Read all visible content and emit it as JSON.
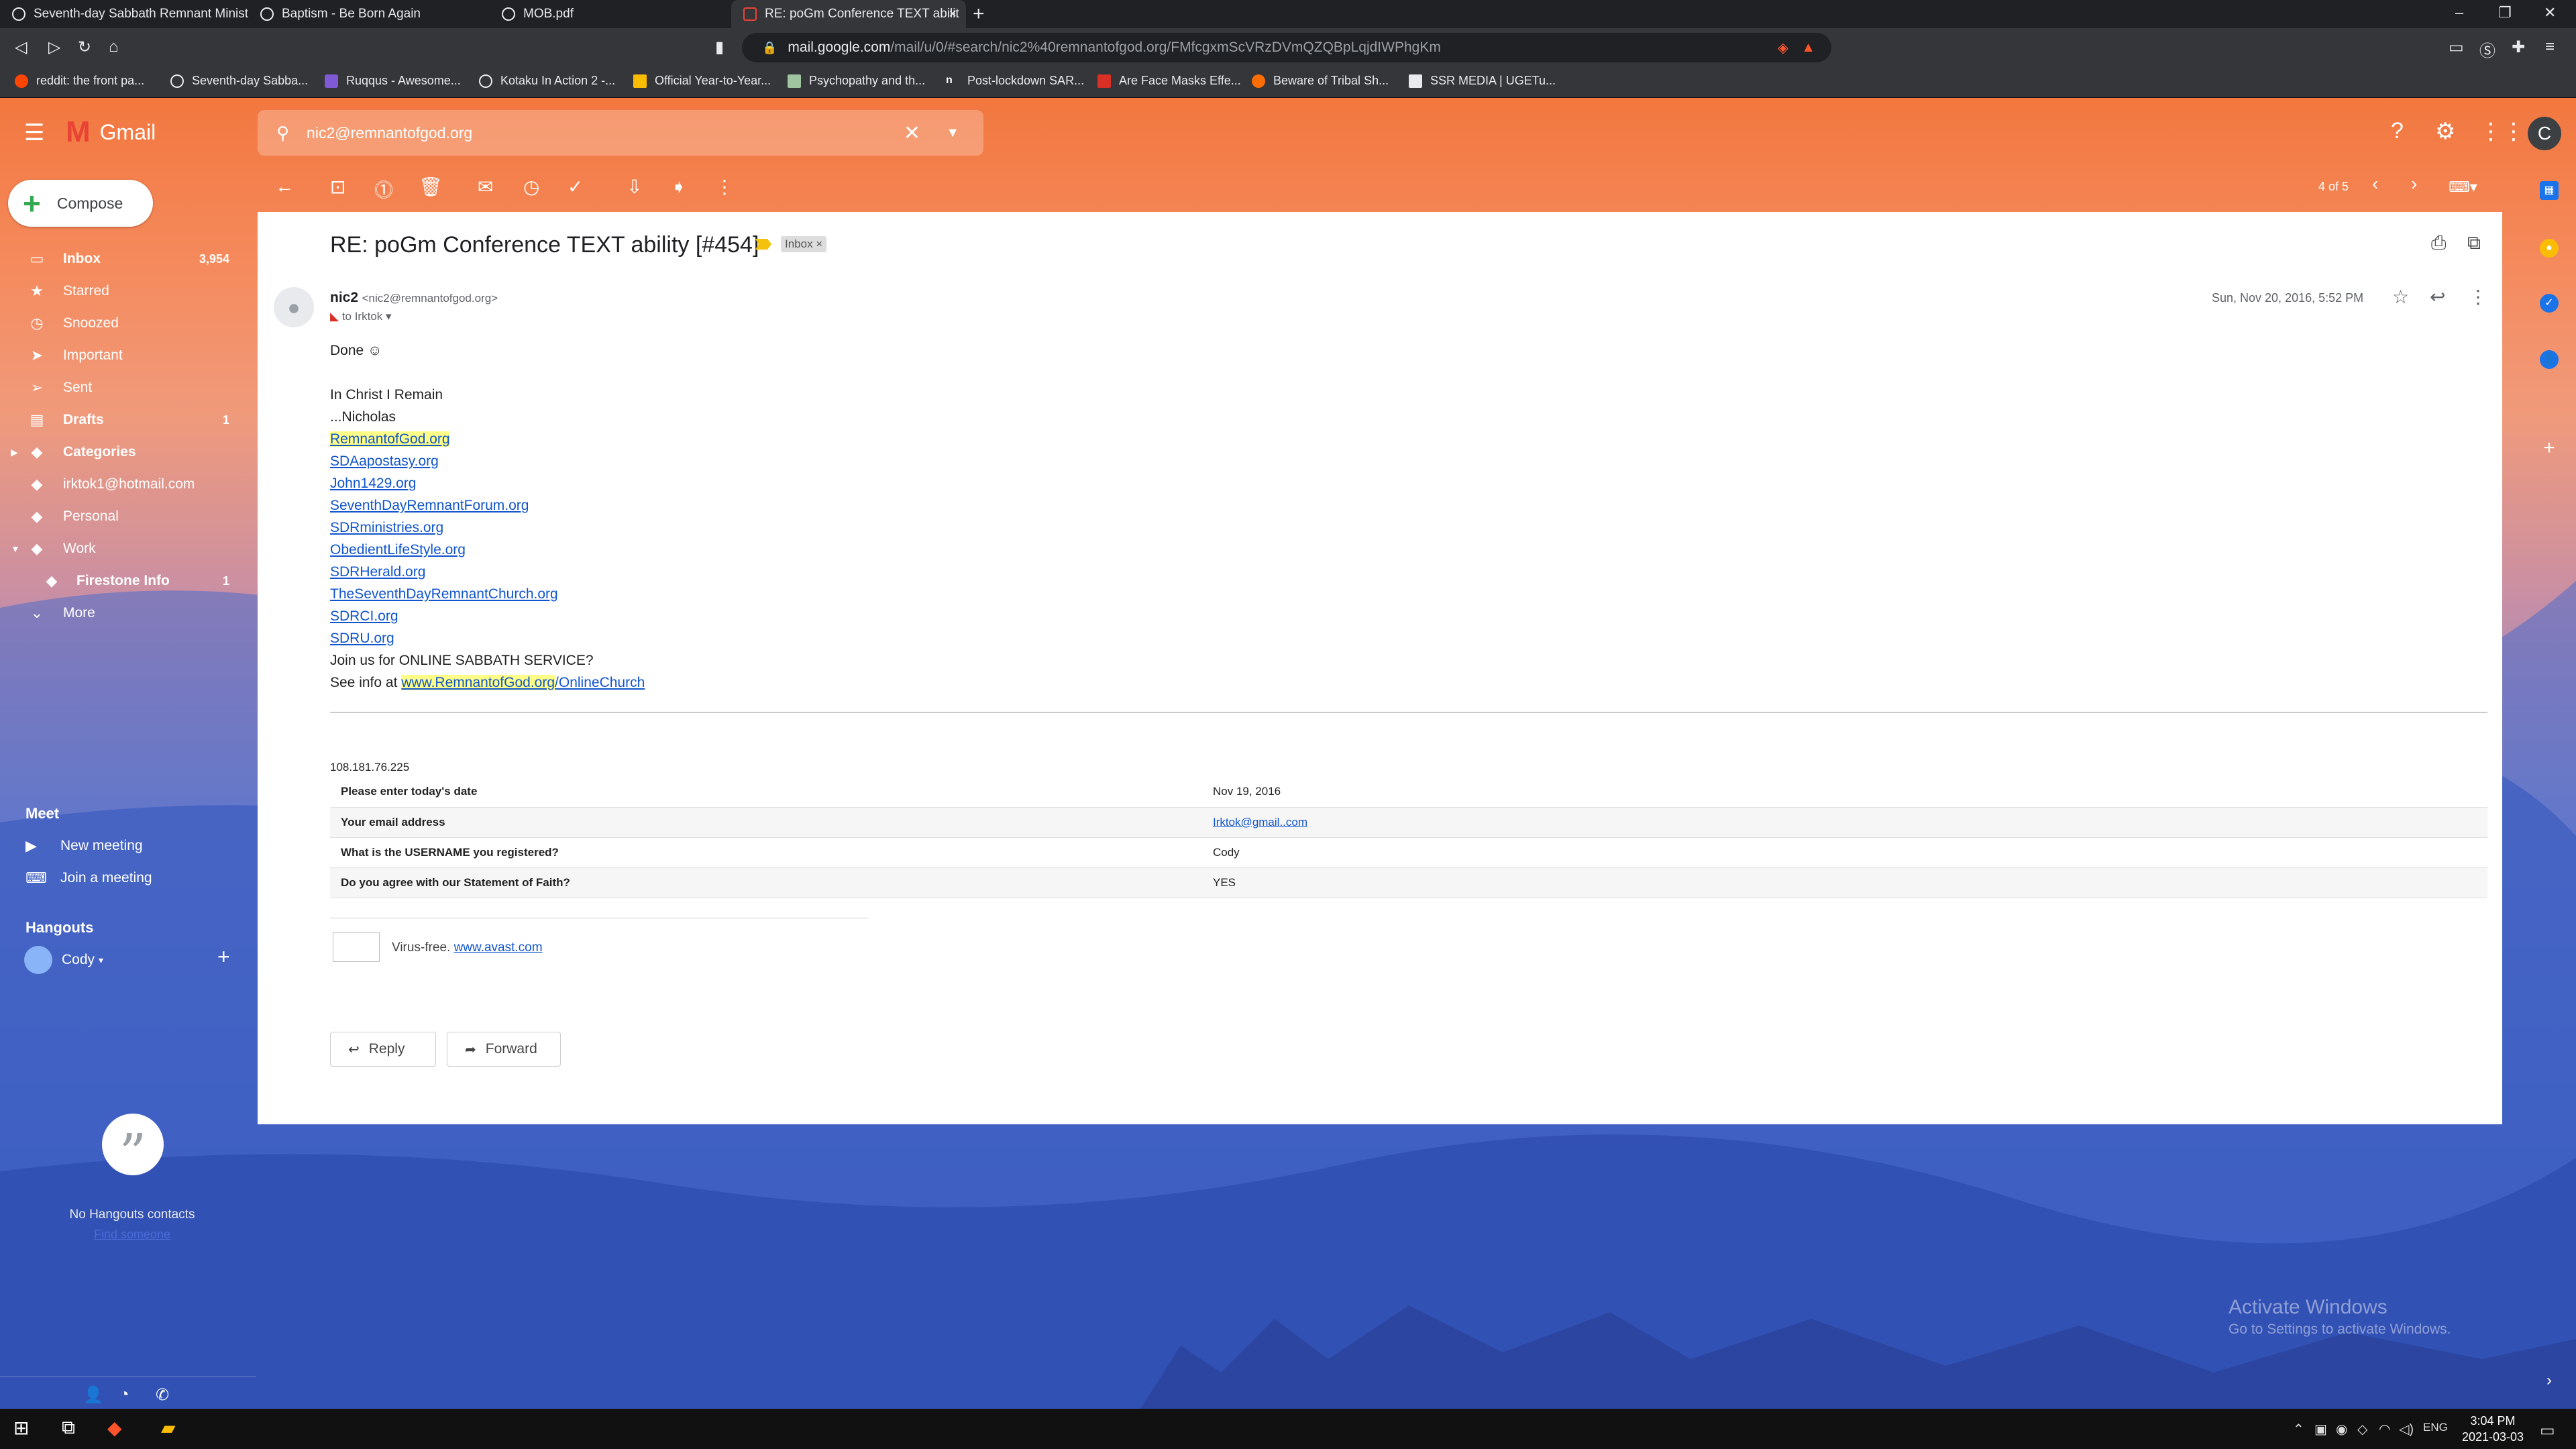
{
  "browser": {
    "tabs": [
      {
        "label": "Seventh-day Sabbath Remnant Minist"
      },
      {
        "label": "Baptism - Be Born Again"
      },
      {
        "label": "MOB.pdf"
      },
      {
        "label": "RE: poGm Conference TEXT abilit"
      }
    ],
    "url_host": "mail.google.com",
    "url_path": "/mail/u/0/#search/nic2%40remnantofgod.org/FMfcgxmScVRzDVmQZQBpLqjdIWPhgKm",
    "bookmarks": [
      {
        "label": "reddit: the front pa...",
        "color": "#ff4500"
      },
      {
        "label": "Seventh-day Sabba...",
        "color": "#e8eaed"
      },
      {
        "label": "Ruqqus - Awesome...",
        "color": "#805ad5"
      },
      {
        "label": "Kotaku In Action 2 -...",
        "color": "#e8eaed"
      },
      {
        "label": "Official Year-to-Year...",
        "color": "#fbbc04"
      },
      {
        "label": "Psychopathy and th...",
        "color": "#e8eaed"
      },
      {
        "label": "Post-lockdown SAR...",
        "color": "#e8eaed"
      },
      {
        "label": "Are Face Masks Effe...",
        "color": "#d93025"
      },
      {
        "label": "Beware of Tribal Sh...",
        "color": "#ff6d00"
      },
      {
        "label": "SSR MEDIA | UGETu...",
        "color": "#e8eaed"
      }
    ]
  },
  "gmail": {
    "logo_text": "Gmail",
    "search_value": "nic2@remnantofgod.org",
    "account_initial": "C",
    "pager": "4 of 5"
  },
  "sidebar": {
    "compose": "Compose",
    "items": [
      {
        "label": "Inbox",
        "count": "3,954",
        "icon": "▭",
        "bold": true
      },
      {
        "label": "Starred",
        "count": "",
        "icon": "★"
      },
      {
        "label": "Snoozed",
        "count": "",
        "icon": "◷"
      },
      {
        "label": "Important",
        "count": "",
        "icon": "➤"
      },
      {
        "label": "Sent",
        "count": "",
        "icon": "➢"
      },
      {
        "label": "Drafts",
        "count": "1",
        "icon": "▤",
        "bold": true
      },
      {
        "label": "Categories",
        "count": "",
        "icon": "◆",
        "bold": true
      },
      {
        "label": "irktok1@hotmail.com",
        "count": "",
        "icon": "◆"
      },
      {
        "label": "Personal",
        "count": "",
        "icon": "◆"
      },
      {
        "label": "Work",
        "count": "",
        "icon": "◆"
      },
      {
        "label": "Firestone Info",
        "count": "1",
        "icon": "◆",
        "bold": true
      },
      {
        "label": "More",
        "count": "",
        "icon": "⌄"
      }
    ],
    "meet_title": "Meet",
    "new_meeting": "New meeting",
    "join_meeting": "Join a meeting",
    "hangouts_title": "Hangouts",
    "hangouts_user": "Cody",
    "no_contacts": "No Hangouts contacts",
    "find_someone": "Find someone"
  },
  "email": {
    "subject": "RE: poGm Conference TEXT ability [#454]",
    "label_chip": "Inbox ×",
    "sender_name": "nic2",
    "sender_email": "<nic2@remnantofgod.org>",
    "to_line": "to Irktok",
    "date": "Sun, Nov 20, 2016, 5:52 PM",
    "greeting": "Done ☺",
    "sign1": "In Christ I Remain",
    "sign2": "...Nicholas",
    "links": [
      "RemnantofGod.org",
      "SDAapostasy.org",
      "John1429.org",
      "SeventhDayRemnantForum.org",
      "SDRministries.org",
      "ObedientLifeStyle.org",
      "SDRHerald.org",
      "TheSeventhDayRemnantChurch.org",
      "SDRCI.org",
      "SDRU.org"
    ],
    "join_text": "Join us for ONLINE SABBATH SERVICE?",
    "see_info": "See info at",
    "see_link_a": "www.RemnantofGod.org",
    "see_link_b": "/OnlineChurch",
    "ip": "108.181.76.225",
    "form": [
      {
        "q": "Please enter today's date",
        "a": "Nov 19, 2016"
      },
      {
        "q": "Your email address",
        "a": "Irktok@gmail..com"
      },
      {
        "q": "What is the USERNAME you registered?",
        "a": "Cody"
      },
      {
        "q": "Do you agree with our Statement of Faith?",
        "a": "YES"
      }
    ],
    "virus_free": "Virus-free.",
    "avast": "www.avast.com",
    "reply": "Reply",
    "forward": "Forward"
  },
  "watermark": {
    "line1": "Activate Windows",
    "line2": "Go to Settings to activate Windows."
  },
  "taskbar": {
    "lang": "ENG",
    "time": "3:04 PM",
    "date": "2021-03-03"
  }
}
